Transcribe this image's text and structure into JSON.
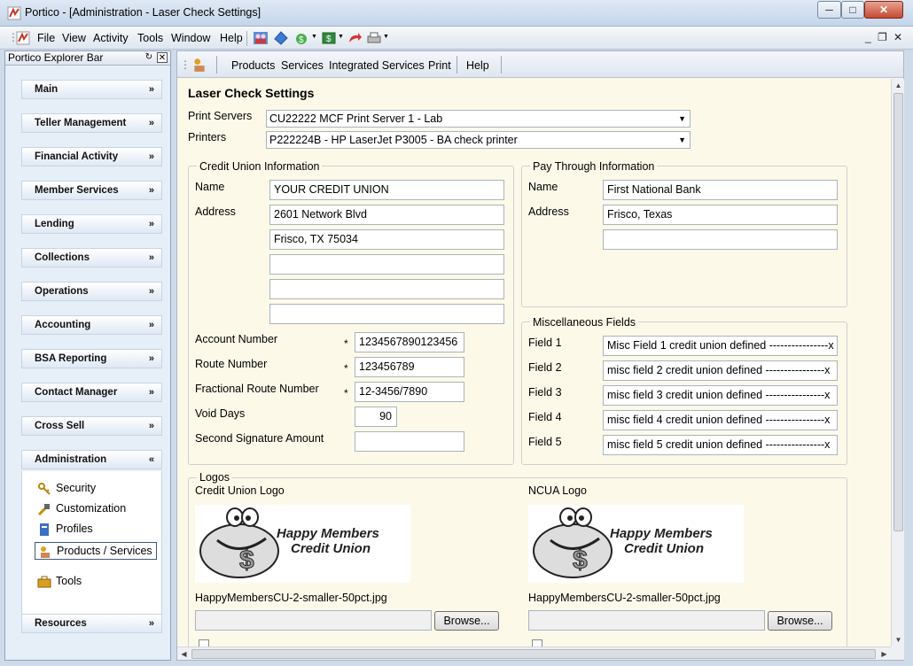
{
  "window": {
    "title": "Portico - [Administration - Laser Check Settings]",
    "buttons": {
      "minimize": "─",
      "maximize": "□",
      "close": "✕"
    }
  },
  "menubar": {
    "items": [
      "File",
      "View",
      "Activity",
      "Tools",
      "Window",
      "Help"
    ],
    "mdi_controls": {
      "minimize": "_",
      "restore": "❐",
      "close": "✕"
    },
    "toolbar_icons": [
      "people-icon",
      "money-icon",
      "cash-icon",
      "dollar-note-icon",
      "redo-arrow-icon",
      "printer-icon"
    ]
  },
  "explorer": {
    "title": "Portico Explorer Bar",
    "groups": [
      "Main",
      "Teller Management",
      "Financial Activity",
      "Member Services",
      "Lending",
      "Collections",
      "Operations",
      "Accounting",
      "BSA Reporting",
      "Contact Manager",
      "Cross Sell",
      "Administration",
      "Resources"
    ],
    "admin_items": [
      {
        "label": "Security",
        "icon": "keys-icon"
      },
      {
        "label": "Customization",
        "icon": "customization-icon"
      },
      {
        "label": "Profiles",
        "icon": "profiles-icon"
      },
      {
        "label": "Products / Services",
        "icon": "products-icon",
        "selected": true
      },
      {
        "label": "Tools",
        "icon": "toolbox-icon"
      }
    ],
    "chevron_down": "»",
    "chevron_up": "«"
  },
  "pane_toolbar": {
    "items": [
      "Products",
      "Services",
      "Integrated Services",
      "Print",
      "Help"
    ]
  },
  "form": {
    "title": "Laser Check Settings",
    "print_servers_label": "Print Servers",
    "print_server_value": "CU22222 MCF Print Server 1 - Lab",
    "printers_label": "Printers",
    "printer_value": "P222224B - HP LaserJet P3005 - BA check printer",
    "cu_info": {
      "legend": "Credit Union Information",
      "name_label": "Name",
      "name": "YOUR CREDIT UNION",
      "address_label": "Address",
      "address": [
        "2601 Network Blvd",
        "Frisco, TX  75034",
        "",
        "",
        ""
      ],
      "account_number_label": "Account Number",
      "account_number": "1234567890123456",
      "route_number_label": "Route Number",
      "route_number": "123456789",
      "fractional_label": "Fractional Route Number",
      "fractional": "12-3456/7890",
      "void_days_label": "Void Days",
      "void_days": "90",
      "second_sig_label": "Second Signature Amount",
      "second_sig": "",
      "required_mark": "*"
    },
    "pay_through": {
      "legend": "Pay Through Information",
      "name_label": "Name",
      "name": "First National Bank",
      "address_label": "Address",
      "address": [
        "Frisco, Texas",
        ""
      ]
    },
    "misc": {
      "legend": "Miscellaneous Fields",
      "fields": [
        {
          "label": "Field 1",
          "value": "Misc Field 1 credit union defined ----------------x"
        },
        {
          "label": "Field 2",
          "value": "misc field 2 credit union defined ----------------x"
        },
        {
          "label": "Field 3",
          "value": "misc field 3 credit union defined ----------------x"
        },
        {
          "label": "Field 4",
          "value": "misc field 4 credit union defined ----------------x"
        },
        {
          "label": "Field 5",
          "value": "misc field 5 credit union defined ----------------x"
        }
      ]
    },
    "logos": {
      "legend": "Logos",
      "cu_logo_label": "Credit Union Logo",
      "cu_logo_file": "HappyMembersCU-2-smaller-50pct.jpg",
      "ncua_logo_label": "NCUA Logo",
      "ncua_logo_file": "HappyMembersCU-2-smaller-50pct.jpg",
      "browse_label": "Browse...",
      "logo_text_1": "Happy Members",
      "logo_text_2": "Credit Union"
    }
  }
}
